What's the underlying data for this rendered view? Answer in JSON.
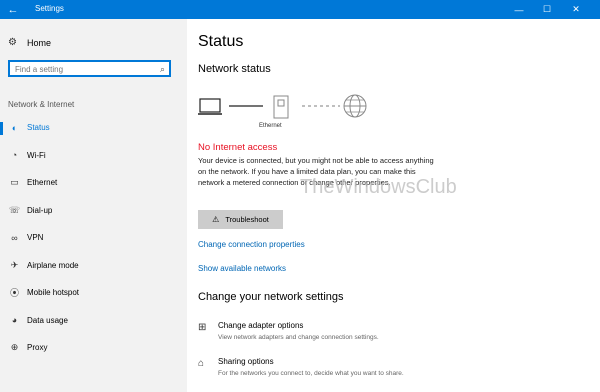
{
  "window": {
    "title": "Settings",
    "back_icon": "back-arrow-icon",
    "minimize": "—",
    "maximize": "☐",
    "close": "✕"
  },
  "sidebar": {
    "home_label": "Home",
    "search_placeholder": "Find a setting",
    "section_label": "Network & Internet",
    "items": [
      {
        "label": "Status",
        "icon": "globe-status-icon",
        "active": true
      },
      {
        "label": "Wi-Fi",
        "icon": "wifi-icon"
      },
      {
        "label": "Ethernet",
        "icon": "ethernet-icon"
      },
      {
        "label": "Dial-up",
        "icon": "dialup-icon"
      },
      {
        "label": "VPN",
        "icon": "vpn-icon"
      },
      {
        "label": "Airplane mode",
        "icon": "airplane-icon"
      },
      {
        "label": "Mobile hotspot",
        "icon": "hotspot-icon"
      },
      {
        "label": "Data usage",
        "icon": "data-usage-icon"
      },
      {
        "label": "Proxy",
        "icon": "proxy-icon"
      }
    ]
  },
  "main": {
    "title": "Status",
    "network_status_heading": "Network status",
    "ethernet_label": "Ethernet",
    "no_internet": "No Internet access",
    "description": "Your device is connected, but you might not be able to access anything on the network. If you have a limited data plan, you can make this network a metered connection or change other properties.",
    "troubleshoot_label": "Troubleshoot",
    "change_connection_link": "Change connection properties",
    "show_networks_link": "Show available networks",
    "change_settings_heading": "Change your network settings",
    "options": [
      {
        "title": "Change adapter options",
        "subtitle": "View network adapters and change connection settings.",
        "icon": "adapter-icon"
      },
      {
        "title": "Sharing options",
        "subtitle": "For the networks you connect to, decide what you want to share.",
        "icon": "sharing-icon"
      }
    ]
  },
  "watermark": "TheWindowsClub",
  "colors": {
    "accent": "#0078d7",
    "error": "#e81123",
    "link": "#0066b4"
  }
}
